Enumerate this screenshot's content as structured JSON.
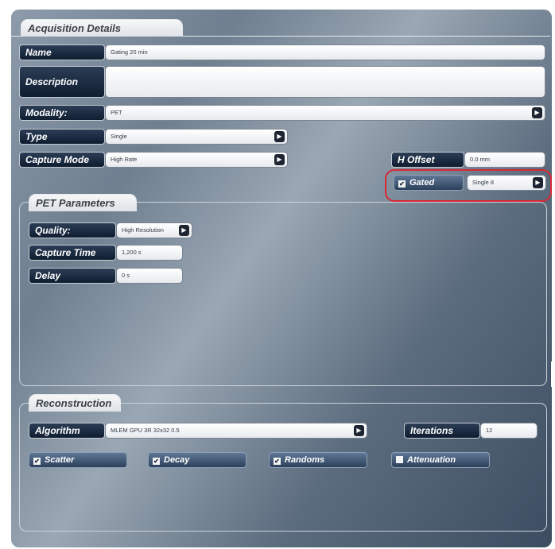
{
  "acquisition": {
    "title": "Acquisition Details",
    "name_label": "Name",
    "name_value": "Gating 20 min",
    "description_label": "Description",
    "description_value": "",
    "modality_label": "Modality:",
    "modality_value": "PET",
    "type_label": "Type",
    "type_value": "Single",
    "capture_mode_label": "Capture Mode",
    "capture_mode_value": "High Rate",
    "h_offset_label": "H Offset",
    "h_offset_value": "0.0 mm",
    "gated_label": "Gated",
    "gated_checked": true,
    "gated_value": "Single 8"
  },
  "pet_parameters": {
    "title": "PET Parameters",
    "quality_label": "Quality:",
    "quality_value": "High Resolution",
    "capture_time_label": "Capture Time",
    "capture_time_value": "1,200 s",
    "delay_label": "Delay",
    "delay_value": "0 s"
  },
  "reconstruction": {
    "title": "Reconstruction",
    "algorithm_label": "Algorithm",
    "algorithm_value": "MLEM GPU 3R 32x32 0.5",
    "iterations_label": "Iterations",
    "iterations_value": "12",
    "options": [
      {
        "label": "Scatter",
        "checked": true
      },
      {
        "label": "Decay",
        "checked": true
      },
      {
        "label": "Randoms",
        "checked": true
      },
      {
        "label": "Attenuation",
        "checked": false
      }
    ]
  },
  "icons": {
    "dropdown": "dropdown-arrow-icon",
    "check": "checkbox-icon"
  },
  "colors": {
    "highlight": "#d62833",
    "label_bg": "#13223a"
  }
}
